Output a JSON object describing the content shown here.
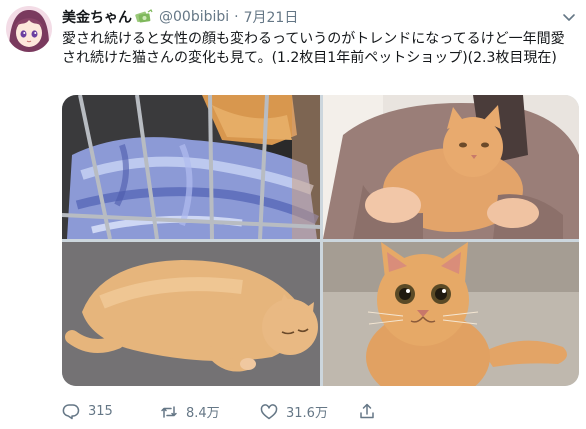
{
  "tweet": {
    "author_name": "美金ちゃん",
    "handle": "@00bibibi",
    "separator": "·",
    "date": "7月21日",
    "text": "愛され続けると女性の顔も変わるっていうのがトレンドになってるけど一年間愛され続けた猫さんの変化も見て。(1.2枚目1年前ペットショップ)(2.3枚目現在)"
  },
  "icons": {
    "avatar": "anime-avatar-icon",
    "badge": "money-bag-icon",
    "menu": "chevron-down-icon",
    "reply": "reply-icon",
    "retweet": "retweet-icon",
    "like": "heart-icon",
    "share": "share-icon"
  },
  "actions": {
    "reply_count": "315",
    "retweet_count": "8.4万",
    "like_count": "31.6万"
  },
  "colors": {
    "text": "#14171a",
    "secondary": "#657786",
    "background": "#ffffff"
  }
}
